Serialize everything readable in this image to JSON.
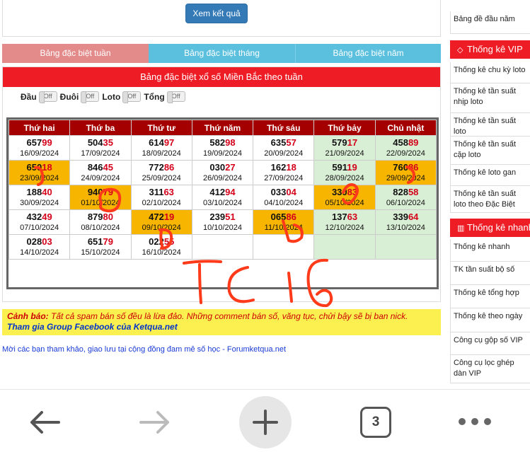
{
  "top": {
    "view_button": "Xem kết quả"
  },
  "tabs": [
    "Bảng đặc biệt tuần",
    "Bảng đặc biệt tháng",
    "Bảng đặc biệt năm"
  ],
  "table_title": "Bảng đặc biệt xổ số Miền Bắc theo tuần",
  "filters": [
    {
      "label": "Đầu",
      "state": "Off"
    },
    {
      "label": "Đuôi",
      "state": "Off"
    },
    {
      "label": "Loto",
      "state": "Off"
    },
    {
      "label": "Tổng",
      "state": "Off"
    }
  ],
  "weekdays": [
    "Thứ hai",
    "Thứ ba",
    "Thứ tư",
    "Thứ năm",
    "Thứ sáu",
    "Thứ bảy",
    "Chủ nhật"
  ],
  "rows": [
    [
      {
        "pre": "657",
        "hl": "99",
        "date": "16/09/2024",
        "bg": "white"
      },
      {
        "pre": "504",
        "hl": "35",
        "date": "17/09/2024",
        "bg": "white"
      },
      {
        "pre": "614",
        "hl": "97",
        "date": "18/09/2024",
        "bg": "white"
      },
      {
        "pre": "582",
        "hl": "98",
        "date": "19/09/2024",
        "bg": "white"
      },
      {
        "pre": "635",
        "hl": "57",
        "date": "20/09/2024",
        "bg": "white"
      },
      {
        "pre": "579",
        "hl": "17",
        "date": "21/09/2024",
        "bg": "green"
      },
      {
        "pre": "458",
        "hl": "89",
        "date": "22/09/2024",
        "bg": "green"
      }
    ],
    [
      {
        "pre": "650",
        "hl": "18",
        "date": "23/09/2024",
        "bg": "orange"
      },
      {
        "pre": "846",
        "hl": "45",
        "date": "24/09/2024",
        "bg": "white"
      },
      {
        "pre": "772",
        "hl": "86",
        "date": "25/09/2024",
        "bg": "white"
      },
      {
        "pre": "030",
        "hl": "27",
        "date": "26/09/2024",
        "bg": "white"
      },
      {
        "pre": "162",
        "hl": "18",
        "date": "27/09/2024",
        "bg": "white"
      },
      {
        "pre": "591",
        "hl": "19",
        "date": "28/09/2024",
        "bg": "green"
      },
      {
        "pre": "760",
        "hl": "86",
        "date": "29/09/2024",
        "bg": "orange"
      }
    ],
    [
      {
        "pre": "188",
        "hl": "40",
        "date": "30/09/2024",
        "bg": "white"
      },
      {
        "pre": "940",
        "hl": "79",
        "date": "01/10/2024",
        "bg": "orange"
      },
      {
        "pre": "311",
        "hl": "63",
        "date": "02/10/2024",
        "bg": "white"
      },
      {
        "pre": "412",
        "hl": "94",
        "date": "03/10/2024",
        "bg": "white"
      },
      {
        "pre": "033",
        "hl": "04",
        "date": "04/10/2024",
        "bg": "white"
      },
      {
        "pre": "330",
        "hl": "83",
        "date": "05/10/2024",
        "bg": "orange"
      },
      {
        "pre": "828",
        "hl": "58",
        "date": "06/10/2024",
        "bg": "green"
      }
    ],
    [
      {
        "pre": "432",
        "hl": "49",
        "date": "07/10/2024",
        "bg": "white"
      },
      {
        "pre": "879",
        "hl": "80",
        "date": "08/10/2024",
        "bg": "white"
      },
      {
        "pre": "472",
        "hl": "19",
        "date": "09/10/2024",
        "bg": "orange"
      },
      {
        "pre": "239",
        "hl": "51",
        "date": "10/10/2024",
        "bg": "white"
      },
      {
        "pre": "065",
        "hl": "86",
        "date": "11/10/2024",
        "bg": "orange"
      },
      {
        "pre": "137",
        "hl": "63",
        "date": "12/10/2024",
        "bg": "green"
      },
      {
        "pre": "339",
        "hl": "64",
        "date": "13/10/2024",
        "bg": "green"
      }
    ],
    [
      {
        "pre": "028",
        "hl": "03",
        "date": "14/10/2024",
        "bg": "white"
      },
      {
        "pre": "651",
        "hl": "79",
        "date": "15/10/2024",
        "bg": "white"
      },
      {
        "pre": "022",
        "hl": "55",
        "date": "16/10/2024",
        "bg": "white"
      },
      {
        "pre": "",
        "hl": "",
        "date": "",
        "bg": "white"
      },
      {
        "pre": "",
        "hl": "",
        "date": "",
        "bg": "white"
      },
      {
        "pre": "",
        "hl": "",
        "date": "",
        "bg": "green"
      },
      {
        "pre": "",
        "hl": "",
        "date": "",
        "bg": "green"
      }
    ]
  ],
  "warning": {
    "prefix": "Cảnh báo:",
    "text": " Tất cả spam bán số đều là lừa đảo. Những comment bán số, văng tục, chửi bậy sẽ bị ban nick.",
    "group_link": "Tham gia Group Facebook của Ketqua.net"
  },
  "forum_link": "Mời các bạn tham khảo, giao lưu tại cộng đồng đam mê số học - Forumketqua.net",
  "sidebar": {
    "top_items": [
      "Bảng đề đầu năm"
    ],
    "section1": "Thống kê VIP",
    "section1_items": [
      "Thống kê chu kỳ loto",
      "Thống kê tần suất nhịp loto",
      "Thống kê tần suất loto",
      "Thống kê tần suất cặp loto",
      "Thống kê loto gan",
      "Thống kê tần suất loto theo Đặc Biệt"
    ],
    "section2": "Thống kê nhanh",
    "section2_items": [
      "Thống kê nhanh",
      "TK tần suất bộ số",
      "Thống kê tổng hợp",
      "Thống kê theo ngày",
      "Công cụ gộp số VIP",
      "Công cụ lọc ghép dàn VIP"
    ]
  },
  "browser": {
    "tabs_count": "3"
  },
  "colors": {
    "accent_red": "#ee1c25",
    "header_dark_red": "#a50000",
    "highlight_orange": "#f7b500",
    "weekend_green": "#d9efd5",
    "link_blue": "#1a3bd6"
  }
}
